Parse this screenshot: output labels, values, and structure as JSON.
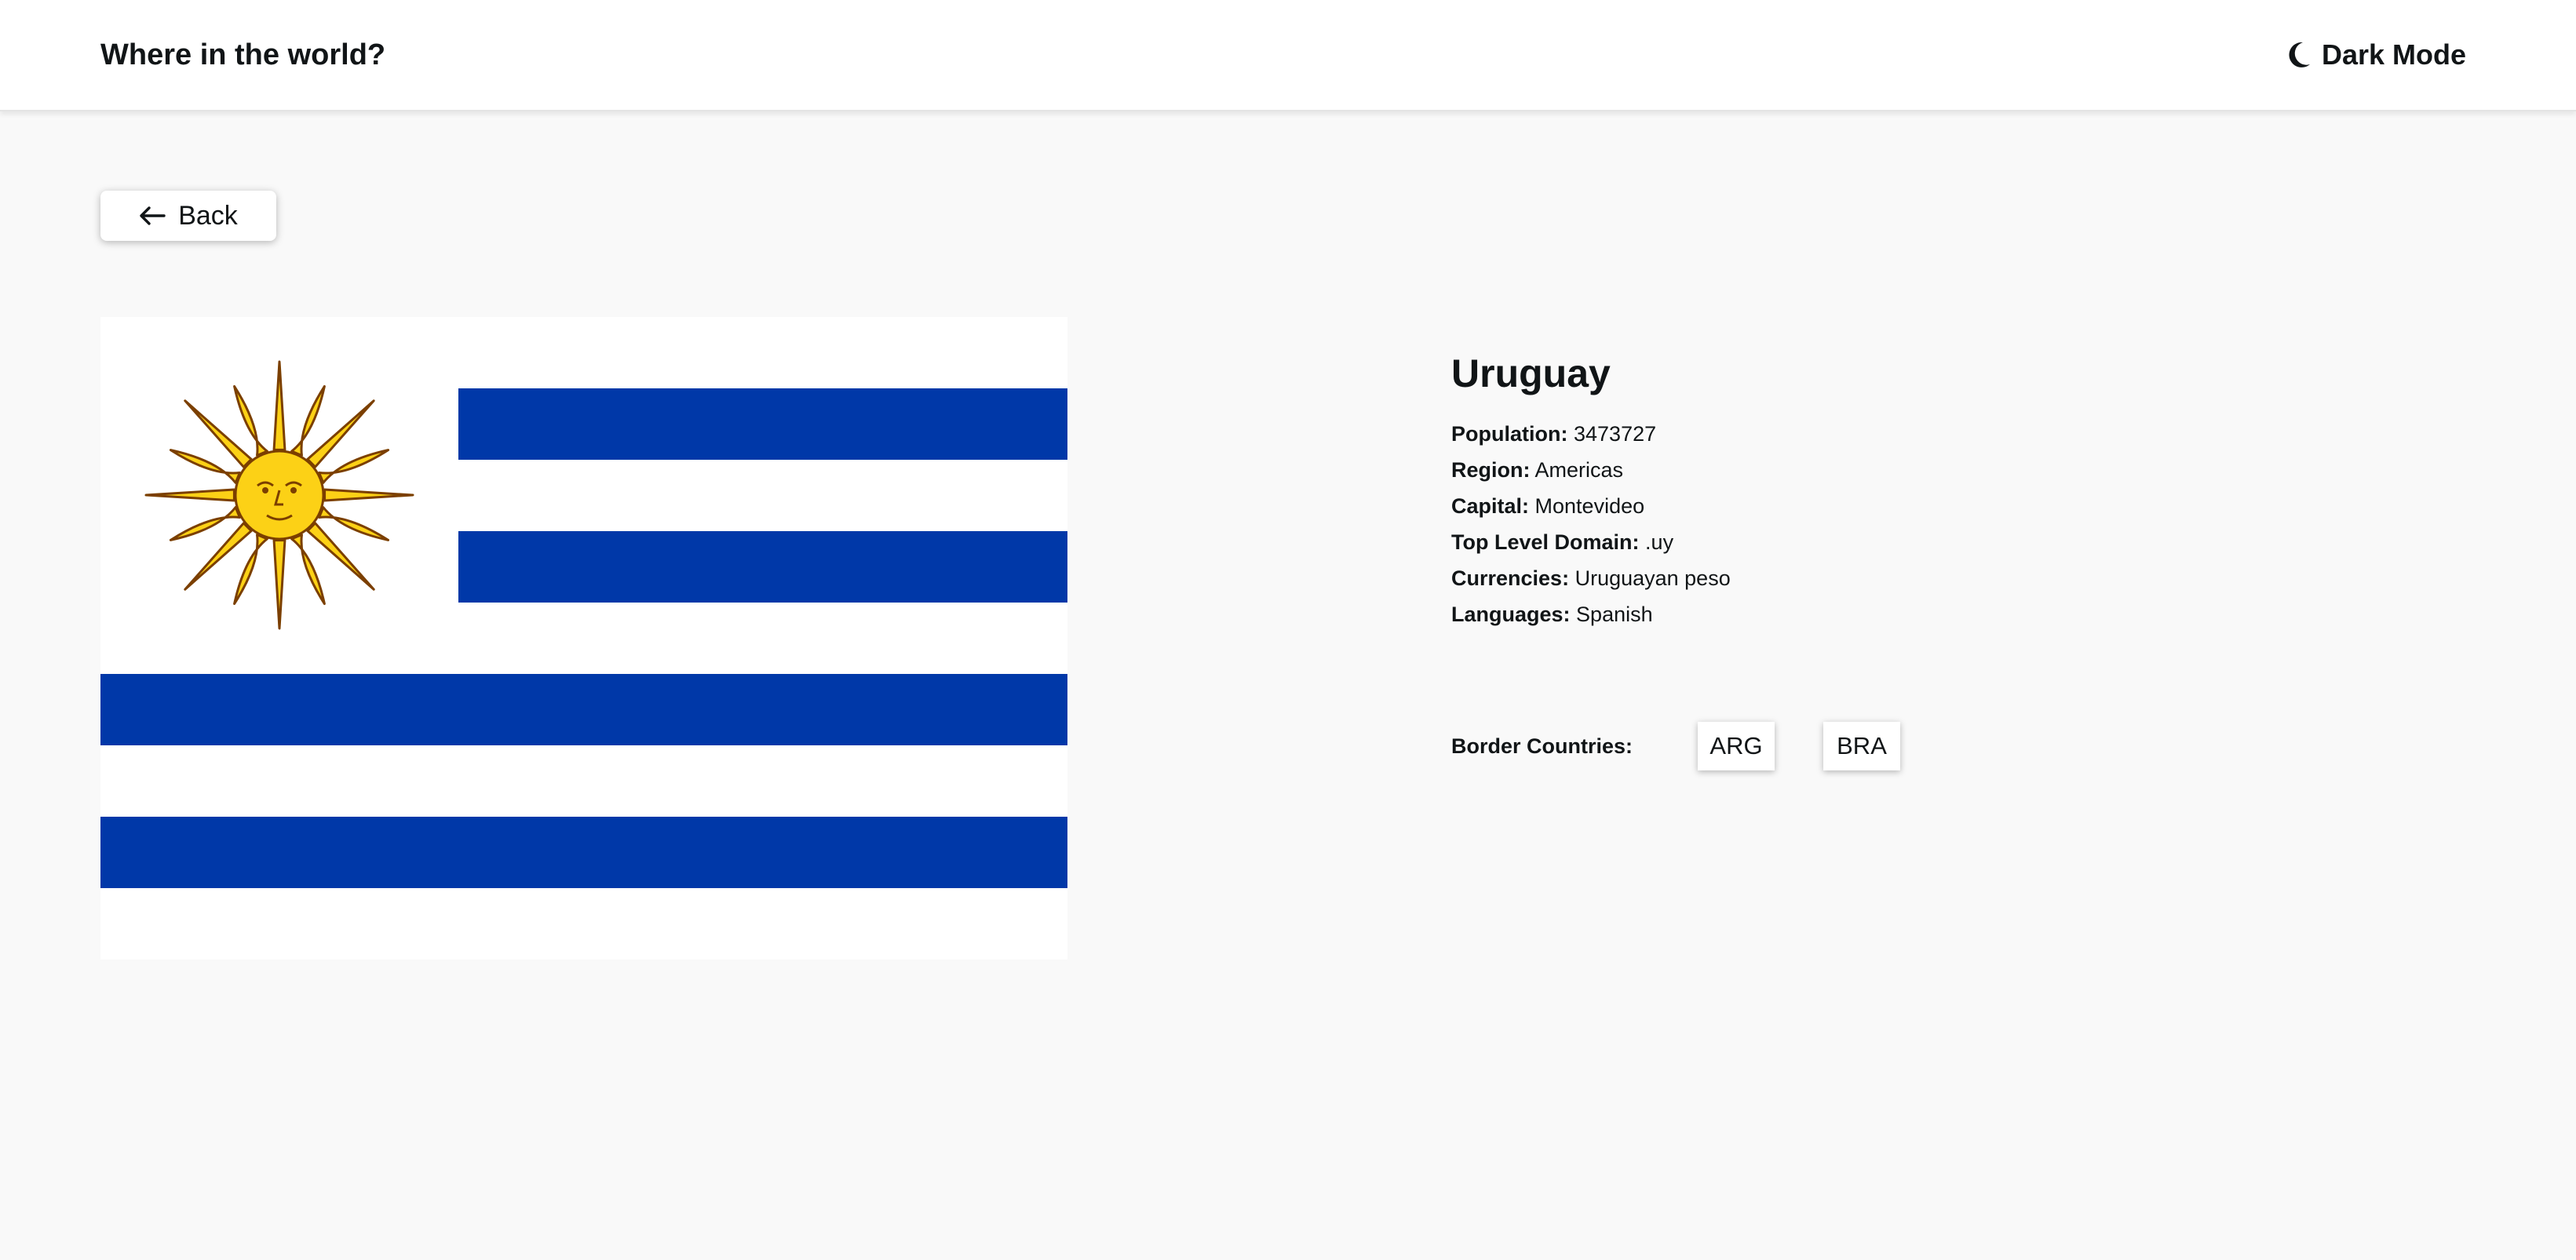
{
  "header": {
    "title": "Where in the world?",
    "theme_toggle": {
      "label": "Dark Mode",
      "icon": "moon-icon"
    }
  },
  "back_button": {
    "label": "Back",
    "icon": "arrow-left-icon"
  },
  "country": {
    "name": "Uruguay",
    "flag": {
      "alt": "Flag of Uruguay",
      "colors": {
        "blue": "#0038a8",
        "white": "#ffffff",
        "sun": "#fcd116",
        "sun_outline": "#7b3f00"
      }
    },
    "fields": [
      {
        "label": "Population:",
        "value": "3473727"
      },
      {
        "label": "Region:",
        "value": "Americas"
      },
      {
        "label": "Capital:",
        "value": "Montevideo"
      },
      {
        "label": "Top Level Domain:",
        "value": ".uy"
      },
      {
        "label": "Currencies:",
        "value": "Uruguayan peso"
      },
      {
        "label": "Languages:",
        "value": "Spanish"
      }
    ],
    "border_label": "Border Countries:",
    "borders": [
      "ARG",
      "BRA"
    ]
  },
  "colors": {
    "background": "#f9f9f9",
    "surface": "#ffffff",
    "text": "#111517"
  }
}
